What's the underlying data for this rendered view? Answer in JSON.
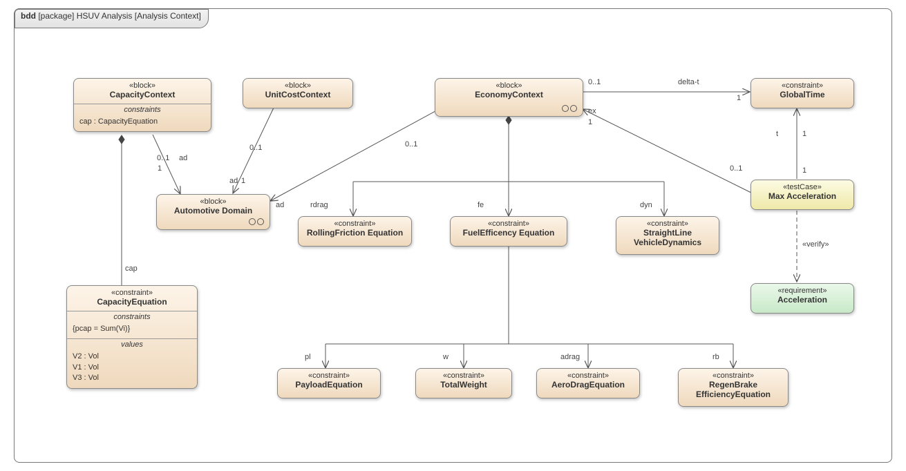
{
  "frame": {
    "type": "bdd",
    "pkg": "[package]",
    "title": "HSUV Analysis",
    "context": "[Analysis Context]"
  },
  "blocks": {
    "capacityContext": {
      "stereo": "«block»",
      "name": "CapacityContext",
      "sect1": "constraints",
      "body1": "cap : CapacityEquation"
    },
    "unitCostContext": {
      "stereo": "«block»",
      "name": "UnitCostContext"
    },
    "economyContext": {
      "stereo": "«block»",
      "name": "EconomyContext"
    },
    "autoDomain": {
      "stereo": "«block»",
      "name": "Automotive Domain"
    },
    "capacityEq": {
      "stereo": "«constraint»",
      "name": "CapacityEquation",
      "sect1": "constraints",
      "body1": "{pcap = Sum(Vi)}",
      "sect2": "values",
      "body2a": "V2 : Vol",
      "body2b": "V1 : Vol",
      "body2c": "V3 : Vol"
    },
    "rolling": {
      "stereo": "«constraint»",
      "name": "RollingFriction Equation"
    },
    "fuelEff": {
      "stereo": "«constraint»",
      "name": "FuelEfficency Equation"
    },
    "slvd": {
      "stereo": "«constraint»",
      "name1": "StraightLine",
      "name2": "VehicleDynamics"
    },
    "global": {
      "stereo": "«constraint»",
      "name": "GlobalTime"
    },
    "payload": {
      "stereo": "«constraint»",
      "name": "PayloadEquation"
    },
    "totalW": {
      "stereo": "«constraint»",
      "name": "TotalWeight"
    },
    "aero": {
      "stereo": "«constraint»",
      "name": "AeroDragEquation"
    },
    "regen": {
      "stereo": "«constraint»",
      "name1": "RegenBrake",
      "name2": "EfficiencyEquation"
    },
    "maxAccel": {
      "stereo": "«testCase»",
      "name": "Max Acceleration"
    },
    "accelReq": {
      "stereo": "«requirement»",
      "name": "Acceleration"
    }
  },
  "labels": {
    "ad1": "ad",
    "ad2": "ad",
    "ad3": "ad",
    "cap": "cap",
    "rdrag": "rdrag",
    "fe": "fe",
    "dyn": "dyn",
    "pl": "pl",
    "w": "w",
    "adrag": "adrag",
    "rb": "rb",
    "deltaT": "delta-t",
    "ex": "ex",
    "t": "t",
    "m01a": "0..1",
    "m01b": "0..1",
    "m01c": "0..1",
    "m01d": "0..1",
    "m01e": "0..1",
    "m1a": "1",
    "m1b": "1",
    "m1c": "1",
    "m1d": "1",
    "m1e": "1",
    "m1f": "1",
    "verify": "«verify»"
  },
  "chart_data": {
    "type": "SysML Block Definition Diagram",
    "directed_associations": [
      {
        "from": "CapacityContext",
        "to": "Automotive Domain",
        "role": "ad",
        "mult_from": "0..1",
        "mult_to": "1"
      },
      {
        "from": "UnitCostContext",
        "to": "Automotive Domain",
        "role": "ad",
        "mult_from": "0..1",
        "mult_to": "1"
      },
      {
        "from": "EconomyContext",
        "to": "Automotive Domain",
        "role": "ad",
        "mult_from": "0..1",
        "mult_to": "1"
      },
      {
        "from": "EconomyContext",
        "to": "GlobalTime",
        "role": "delta-t",
        "mult_from": "0..1",
        "mult_to": "1"
      },
      {
        "from": "Max Acceleration",
        "to": "EconomyContext",
        "role": "ex",
        "mult_from": "0..1",
        "mult_to": "1"
      },
      {
        "from": "Max Acceleration",
        "to": "GlobalTime",
        "role": "t",
        "mult_from": "0..1",
        "mult_to": "1"
      }
    ],
    "compositions": [
      {
        "whole": "CapacityContext",
        "part": "CapacityEquation",
        "role": "cap"
      },
      {
        "whole": "EconomyContext",
        "part": "RollingFriction Equation",
        "role": "rdrag"
      },
      {
        "whole": "EconomyContext",
        "part": "FuelEfficency Equation",
        "role": "fe"
      },
      {
        "whole": "EconomyContext",
        "part": "StraightLine VehicleDynamics",
        "role": "dyn"
      },
      {
        "whole": "EconomyContext",
        "part": "PayloadEquation",
        "role": "pl"
      },
      {
        "whole": "EconomyContext",
        "part": "TotalWeight",
        "role": "w"
      },
      {
        "whole": "EconomyContext",
        "part": "AeroDragEquation",
        "role": "adrag"
      },
      {
        "whole": "EconomyContext",
        "part": "RegenBrake EfficiencyEquation",
        "role": "rb"
      }
    ],
    "dependencies": [
      {
        "from": "Max Acceleration",
        "to": "Acceleration",
        "stereotype": "verify"
      }
    ]
  }
}
